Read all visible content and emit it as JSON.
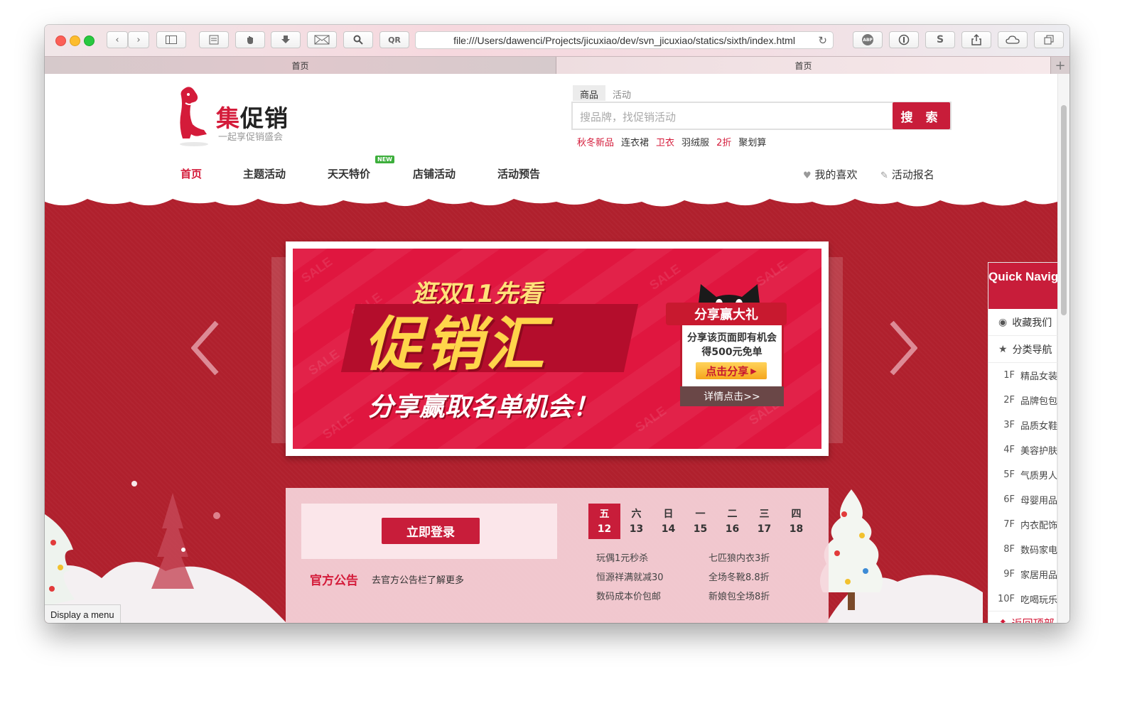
{
  "browser": {
    "url": "file:///Users/dawenci/Projects/jicuxiao/dev/svn_jicuxiao/statics/sixth/index.html",
    "tabs": [
      "首页",
      "首页"
    ],
    "toolbar_qr": "QR",
    "ext_abp": "ABP",
    "ext_s": "S",
    "status_tip": "Display a menu"
  },
  "header": {
    "logo_title_red": "集",
    "logo_title_dark": "促销",
    "logo_slogan": "一起享促销盛会",
    "search_tabs": [
      "商品",
      "活动"
    ],
    "search_placeholder": "搜品牌，找促销活动",
    "search_button": "搜 索",
    "hot_words": [
      {
        "text": "秋冬新品",
        "color": "#d41b3a"
      },
      {
        "text": "连衣裙",
        "color": "#333333"
      },
      {
        "text": "卫衣",
        "color": "#d41b3a"
      },
      {
        "text": "羽绒服",
        "color": "#333333"
      },
      {
        "text": "2折",
        "color": "#d41b3a"
      },
      {
        "text": "聚划算",
        "color": "#333333"
      }
    ]
  },
  "nav": {
    "items": [
      "首页",
      "主题活动",
      "天天特价",
      "店铺活动",
      "活动预告"
    ],
    "new_badge": "NEW",
    "favorites": "我的喜欢",
    "signup": "活动报名"
  },
  "banner": {
    "headline_top": "逛双11先看",
    "headline_big": "促销汇",
    "slogan": "分享赢取名单机会！",
    "watermark": "SALE",
    "promo_title": "分享赢大礼",
    "promo_line1": "分享该页面即有机会",
    "promo_line2": "得500元免单",
    "promo_share": "点击分享",
    "promo_detail": "详情点击>>"
  },
  "panel": {
    "login_button": "立即登录",
    "notice_title": "官方公告",
    "notice_text": "去官方公告栏了解更多",
    "days": [
      {
        "weekday": "五",
        "date": "12",
        "active": true
      },
      {
        "weekday": "六",
        "date": "13",
        "active": false
      },
      {
        "weekday": "日",
        "date": "14",
        "active": false
      },
      {
        "weekday": "一",
        "date": "15",
        "active": false
      },
      {
        "weekday": "二",
        "date": "16",
        "active": false
      },
      {
        "weekday": "三",
        "date": "17",
        "active": false
      },
      {
        "weekday": "四",
        "date": "18",
        "active": false
      }
    ],
    "deals": [
      "玩偶1元秒杀",
      "七匹狼内衣3折",
      "恒源祥满就减30",
      "全场冬靴8.8折",
      "数码成本价包邮",
      "新娘包全场8折"
    ]
  },
  "quick_nav": {
    "title": "Quick Navigation",
    "bookmark": "收藏我们",
    "categories": "分类导航",
    "floors": [
      {
        "floor": "1F",
        "name": "精品女装"
      },
      {
        "floor": "2F",
        "name": "品牌包包"
      },
      {
        "floor": "3F",
        "name": "品质女鞋"
      },
      {
        "floor": "4F",
        "name": "美容护肤"
      },
      {
        "floor": "5F",
        "name": "气质男人"
      },
      {
        "floor": "6F",
        "name": "母婴用品"
      },
      {
        "floor": "7F",
        "name": "内衣配饰"
      },
      {
        "floor": "8F",
        "name": "数码家电"
      },
      {
        "floor": "9F",
        "name": "家居用品"
      },
      {
        "floor": "10F",
        "name": "吃喝玩乐"
      }
    ],
    "back_to_top": "返回顶部"
  },
  "colors": {
    "brand_red": "#c81d3a",
    "festive_bg": "#b0202d",
    "banner_red": "#e0163f"
  }
}
